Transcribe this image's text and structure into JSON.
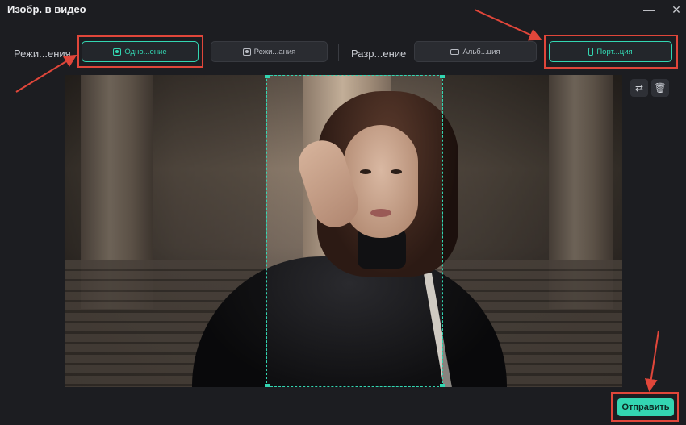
{
  "window": {
    "title": "Изобр. в видео",
    "minimize_icon": "minimize-icon",
    "close_icon": "close-icon"
  },
  "toolbar": {
    "mode_label": "Режи...ения",
    "mode_options": [
      {
        "label": "Одно...ение",
        "icon": "user-frame-icon",
        "active": true
      },
      {
        "label": "Режи...ания",
        "icon": "user-frame-icon",
        "active": false
      }
    ],
    "ratio_label": "Разр...ение",
    "ratio_options": [
      {
        "label": "Альб...ция",
        "icon": "landscape-icon",
        "active": false
      },
      {
        "label": "Порт...ция",
        "icon": "portrait-icon",
        "active": true
      }
    ]
  },
  "preview": {
    "crop_frame": "dashed",
    "tools": [
      "replace-image-icon",
      "trash-icon"
    ]
  },
  "footer": {
    "submit_label": "Отправить"
  },
  "colors": {
    "accent": "#33d6b2",
    "annotation": "#e0463a",
    "background": "#1c1d21"
  }
}
